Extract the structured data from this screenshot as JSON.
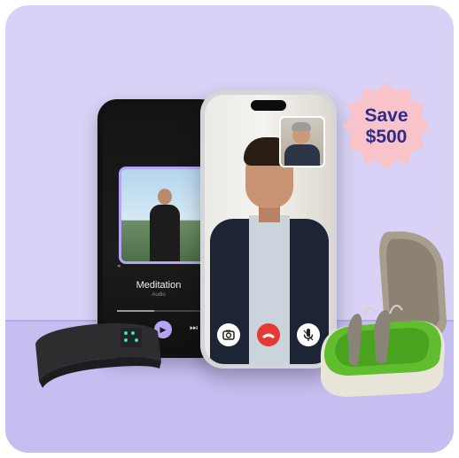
{
  "promo": {
    "badge_line1": "Save",
    "badge_line2": "$500",
    "badge_color": "#f8c4c9",
    "badge_text_color": "#2f2a8c",
    "background_color": "#d9d2f6"
  },
  "music_player": {
    "track_title": "Meditation",
    "track_subtitle": "Audio",
    "progress": 0.45,
    "play_icon": "play-icon",
    "next_icon": "skip-next-icon",
    "prev_icon": "skip-previous-icon"
  },
  "video_call": {
    "camera_icon": "camera-icon",
    "end_call_icon": "end-call-icon",
    "mic_icon": "microphone-icon"
  }
}
